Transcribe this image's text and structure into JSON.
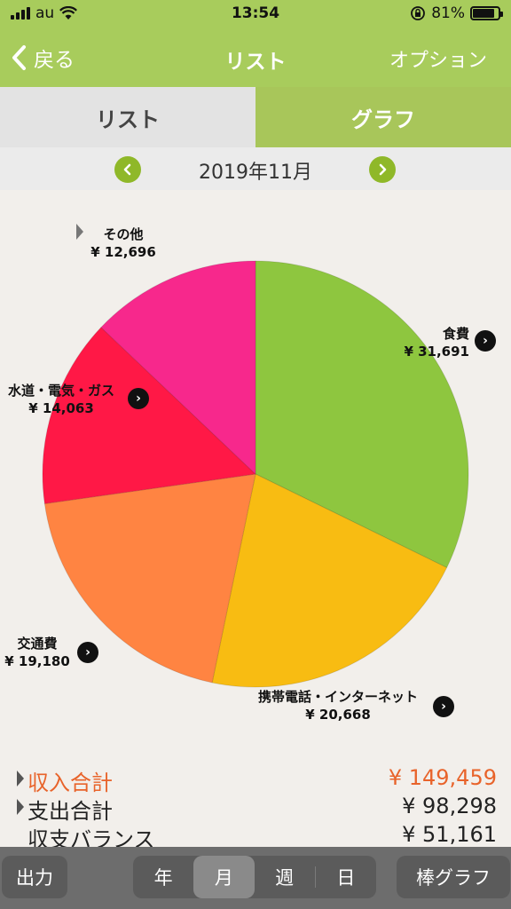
{
  "status": {
    "carrier": "au",
    "time": "13:54",
    "battery": "81%"
  },
  "nav": {
    "back_label": "戻る",
    "title": "リスト",
    "option_label": "オプション"
  },
  "tabs": [
    {
      "label": "リスト",
      "active": false
    },
    {
      "label": "グラフ",
      "active": true
    }
  ],
  "month": {
    "label": "2019年11月"
  },
  "chart_data": {
    "type": "pie",
    "categories": [
      "食費",
      "携帯電話・インターネット",
      "交通費",
      "水道・電気・ガス",
      "その他"
    ],
    "values": [
      31691,
      20668,
      19180,
      14063,
      12696
    ],
    "value_labels": [
      "¥ 31,691",
      "¥ 20,668",
      "¥ 19,180",
      "¥ 14,063",
      "¥ 12,696"
    ],
    "colors": [
      "#8ec63f",
      "#f8bc12",
      "#ff8442",
      "#ff1846",
      "#f7288c"
    ]
  },
  "summary": {
    "income": {
      "label": "収入合計",
      "value": "¥ 149,459",
      "color": "#e8632a"
    },
    "expense": {
      "label": "支出合計",
      "value": "¥ 98,298"
    },
    "balance": {
      "label": "収支バランス",
      "value": "¥ 51,161"
    }
  },
  "toolbar": {
    "output_label": "出力",
    "periods": [
      "年",
      "月",
      "週",
      "日"
    ],
    "active_period": "月",
    "bar_chart_label": "棒グラフ"
  }
}
